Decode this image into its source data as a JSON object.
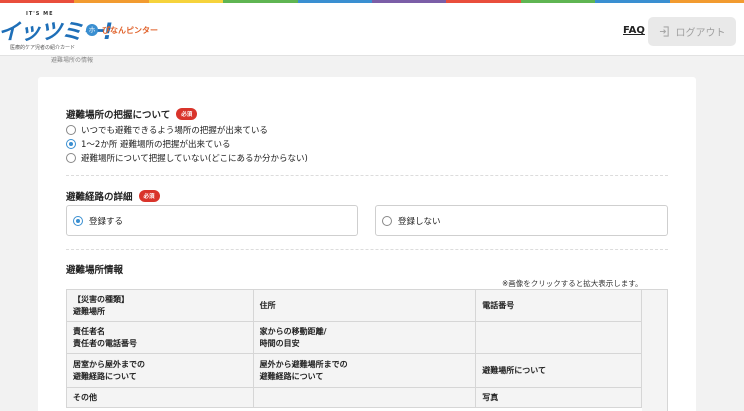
{
  "header": {
    "logo_small": "IT'S ME",
    "logo_main": "イッツミー!",
    "logo_sub": "医療的ケア児者の紹介カード",
    "partner_icon_char": "ホ",
    "partner_text": "ぴなんピンター",
    "faq_label": "FAQ",
    "logout_label": "ログアウト"
  },
  "breadcrumb": "避難場所の情報",
  "section1": {
    "title": "避難場所の把握について",
    "badge": "必須",
    "options": [
      {
        "label": "いつでも避難できるよう場所の把握が出来ている",
        "selected": false
      },
      {
        "label": "1〜2か所 避難場所の把握が出来ている",
        "selected": true
      },
      {
        "label": "避難場所について把握していない(どこにあるか分からない)",
        "selected": false
      }
    ]
  },
  "section2": {
    "title": "避難経路の詳細",
    "badge": "必須",
    "options": [
      {
        "label": "登録する",
        "selected": true
      },
      {
        "label": "登録しない",
        "selected": false
      }
    ]
  },
  "section3": {
    "title": "避難場所情報",
    "note": "※画像をクリックすると拡大表示します。",
    "table": [
      [
        "【災害の種類】\n避難場所",
        "住所",
        "電話番号"
      ],
      [
        "責任者名\n責任者の電話番号",
        "家からの移動距離/\n時間の目安",
        ""
      ],
      [
        "居室から屋外までの\n避難経路について",
        "屋外から避難場所までの\n避難経路について",
        "避難場所について"
      ],
      [
        "その他",
        "",
        "写真"
      ]
    ]
  },
  "colors": {
    "accent": "#3a8fd1",
    "required": "#d9342b",
    "top_stripes": [
      "#e94e3c",
      "#f29b30",
      "#f6d33c",
      "#5fb552",
      "#3a8fd1",
      "#7b5ea7",
      "#e94e3c",
      "#5fb552",
      "#3a8fd1",
      "#f29b30"
    ]
  }
}
